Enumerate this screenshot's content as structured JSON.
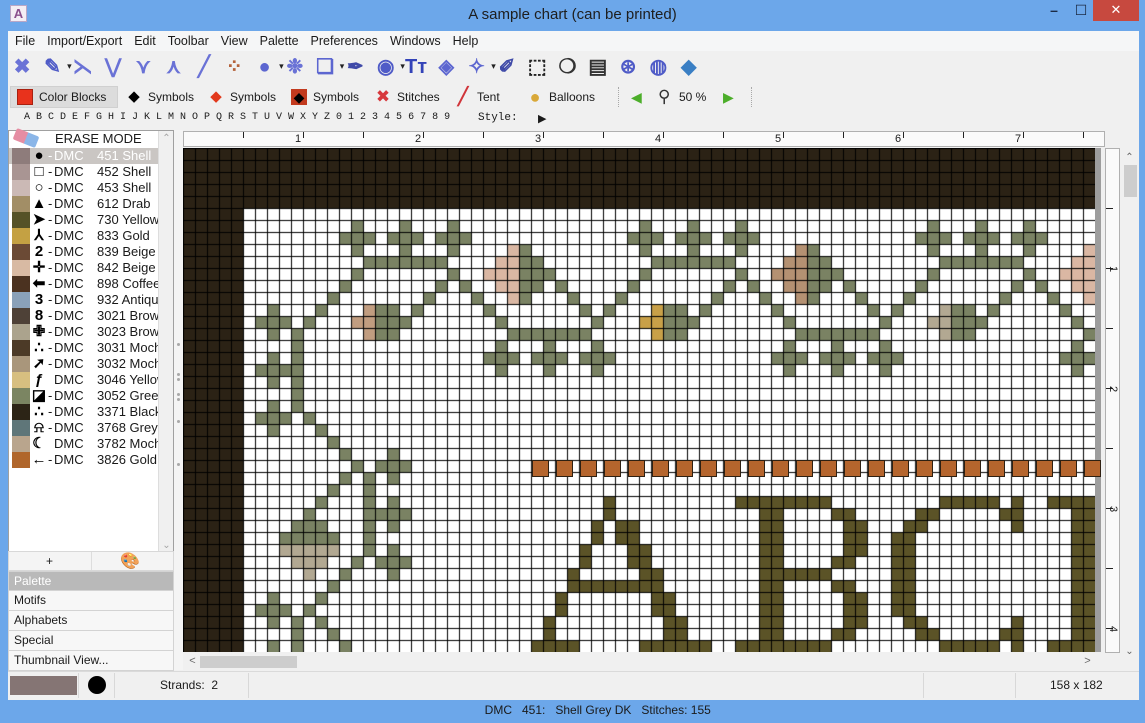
{
  "window": {
    "title": "A sample chart (can be printed)",
    "minimize": "–",
    "maximize": "☐",
    "close": "✕",
    "app_icon": "A"
  },
  "menu": {
    "items": [
      "File",
      "Import/Export",
      "Edit",
      "Toolbar",
      "View",
      "Palette",
      "Preferences",
      "Windows",
      "Help"
    ]
  },
  "toolbar": {
    "dropdown_glyph": "▾",
    "tools": [
      {
        "name": "full-stitch",
        "glyph": "✖",
        "color": "#6a72d6",
        "dropdown": false
      },
      {
        "name": "brush",
        "glyph": "✎",
        "color": "#4f5bc7",
        "dropdown": true
      },
      {
        "name": "half-stitch-back",
        "glyph": "⋋",
        "color": "#6a72d6",
        "dropdown": false
      },
      {
        "name": "three-quarter-stitch-a",
        "glyph": "⋁",
        "color": "#6a72d6",
        "dropdown": false
      },
      {
        "name": "three-quarter-stitch-b",
        "glyph": "⋎",
        "color": "#6a72d6",
        "dropdown": false
      },
      {
        "name": "three-quarter-stitch-c",
        "glyph": "⋏",
        "color": "#6a72d6",
        "dropdown": false
      },
      {
        "name": "half-stitch-forward",
        "glyph": "╱",
        "color": "#6a72d6",
        "dropdown": false
      },
      {
        "name": "quarter-stitch",
        "glyph": "⁘",
        "color": "#b5623a",
        "dropdown": false
      },
      {
        "name": "french-knot",
        "glyph": "●",
        "color": "#5c66d0",
        "dropdown": true
      },
      {
        "name": "bead",
        "glyph": "❉",
        "color": "#6a72d6",
        "dropdown": false
      },
      {
        "name": "shapes",
        "glyph": "❏",
        "color": "#5c66d0",
        "dropdown": true
      },
      {
        "name": "backstitch-pen",
        "glyph": "✒",
        "color": "#3f4aa8",
        "dropdown": false
      },
      {
        "name": "view-eye",
        "glyph": "◉",
        "color": "#4f5bc7",
        "dropdown": true
      },
      {
        "name": "text",
        "glyph": "Tт",
        "color": "#3343b8",
        "dropdown": false
      },
      {
        "name": "fill-bucket",
        "glyph": "◈",
        "color": "#5c66d0",
        "dropdown": false
      },
      {
        "name": "magic-wand",
        "glyph": "✧",
        "color": "#5c66d0",
        "dropdown": true
      },
      {
        "name": "eyedropper",
        "glyph": "✐",
        "color": "#3f4aa8",
        "dropdown": false
      },
      {
        "name": "select-rectangle",
        "glyph": "⬚",
        "color": "#222222",
        "dropdown": false
      },
      {
        "name": "comment-bubble",
        "glyph": "❍",
        "color": "#333333",
        "dropdown": false
      },
      {
        "name": "clipboard-paste",
        "glyph": "▤",
        "color": "#333333",
        "dropdown": false
      },
      {
        "name": "help-lifebuoy",
        "glyph": "⊛",
        "color": "#4f5bc7",
        "dropdown": false
      },
      {
        "name": "globe",
        "glyph": "◍",
        "color": "#4f5bc7",
        "dropdown": false
      },
      {
        "name": "book",
        "glyph": "◆",
        "color": "#3a7fc4",
        "dropdown": false
      }
    ]
  },
  "view_modes": {
    "items": [
      {
        "label": "Color Blocks",
        "selected": true
      },
      {
        "label": "Symbols"
      },
      {
        "label": "Symbols"
      },
      {
        "label": "Symbols"
      },
      {
        "label": "Stitches"
      },
      {
        "label": "Tent"
      },
      {
        "label": "Balloons"
      }
    ],
    "icons": {
      "diamond": "◆",
      "stitches": "✖",
      "tent": "╱",
      "balloon": "●",
      "prev": "◀",
      "next": "▶",
      "zoom": "⚲"
    },
    "zoom_value": "50 %"
  },
  "alphabet_bar": {
    "letters": "A B C D E F G H I J K L M N O P Q R S T U V W X Y Z 0 1 2 3 4 5 6 7 8 9",
    "style_label": "Style:",
    "style_arrow": "▶"
  },
  "palette": {
    "erase_label": "ERASE MODE",
    "add_label": "+",
    "scroll_up": "⌃",
    "scroll_down": "⌄",
    "items": [
      {
        "swatch": "#8e7c7b",
        "symbol": "●",
        "dash": "-",
        "brand": "DMC",
        "code": "451",
        "name": "Shell",
        "selected": true
      },
      {
        "swatch": "#a99593",
        "symbol": "□",
        "dash": "-",
        "brand": "DMC",
        "code": "452",
        "name": "Shell"
      },
      {
        "swatch": "#cbb9b5",
        "symbol": "○",
        "dash": "-",
        "brand": "DMC",
        "code": "453",
        "name": "Shell"
      },
      {
        "swatch": "#a28e66",
        "symbol": "▲",
        "dash": "-",
        "brand": "DMC",
        "code": "612",
        "name": "Drab"
      },
      {
        "swatch": "#555227",
        "symbol": "➤",
        "dash": "-",
        "brand": "DMC",
        "code": "730",
        "name": "Yellow"
      },
      {
        "swatch": "#c4a143",
        "symbol": "⅄",
        "dash": "-",
        "brand": "DMC",
        "code": "833",
        "name": "Gold"
      },
      {
        "swatch": "#6b4a35",
        "symbol": "2",
        "dash": "-",
        "brand": "DMC",
        "code": "839",
        "name": "Beige"
      },
      {
        "swatch": "#d8baa3",
        "symbol": "✛",
        "dash": "-",
        "brand": "DMC",
        "code": "842",
        "name": "Beige"
      },
      {
        "swatch": "#4b3220",
        "symbol": "⬅",
        "dash": "-",
        "brand": "DMC",
        "code": "898",
        "name": "Coffee"
      },
      {
        "swatch": "#8aa1b9",
        "symbol": "3",
        "dash": "-",
        "brand": "DMC",
        "code": "932",
        "name": "Antique"
      },
      {
        "swatch": "#4e4137",
        "symbol": "8",
        "dash": "-",
        "brand": "DMC",
        "code": "3021",
        "name": "Brown"
      },
      {
        "swatch": "#aba38d",
        "symbol": "✙",
        "dash": "-",
        "brand": "DMC",
        "code": "3023",
        "name": "Brown"
      },
      {
        "swatch": "#4c3a27",
        "symbol": "∴",
        "dash": "-",
        "brand": "DMC",
        "code": "3031",
        "name": "Mocha"
      },
      {
        "swatch": "#a9967b",
        "symbol": "➚",
        "dash": "-",
        "brand": "DMC",
        "code": "3032",
        "name": "Mocha"
      },
      {
        "swatch": "#d7bf80",
        "symbol": "ƒ",
        "dash": "",
        "brand": "DMC",
        "code": "3046",
        "name": "Yellow"
      },
      {
        "swatch": "#7b8562",
        "symbol": "◪",
        "dash": "-",
        "brand": "DMC",
        "code": "3052",
        "name": "Green"
      },
      {
        "swatch": "#2c2416",
        "symbol": "∴",
        "dash": "-",
        "brand": "DMC",
        "code": "3371",
        "name": "Black"
      },
      {
        "swatch": "#5f7679",
        "symbol": "⍾",
        "dash": "-",
        "brand": "DMC",
        "code": "3768",
        "name": "Grey"
      },
      {
        "swatch": "#b9a58d",
        "symbol": "☾",
        "dash": "",
        "brand": "DMC",
        "code": "3782",
        "name": "Mocha"
      },
      {
        "swatch": "#b0662b",
        "symbol": "←",
        "dash": "-",
        "brand": "DMC",
        "code": "3826",
        "name": "Gold"
      }
    ]
  },
  "side_tabs": [
    {
      "label": "Palette",
      "selected": true
    },
    {
      "label": "Motifs"
    },
    {
      "label": "Alphabets"
    },
    {
      "label": "Special"
    },
    {
      "label": "Thumbnail View..."
    }
  ],
  "rulers": {
    "horizontal": [
      "1",
      "2",
      "3",
      "4",
      "5",
      "6",
      "7"
    ],
    "vertical": [
      "1",
      "2",
      "3",
      "4"
    ]
  },
  "scrollbars": {
    "left": "<",
    "right": ">",
    "up": "⌃",
    "down": "⌄"
  },
  "chart": {
    "cols": 76,
    "rows": 42,
    "legend": {
      "K": "#2b2215",
      ".": "#ffffff",
      "g": "#7a8263",
      "p": "#dab7a3",
      "b": "#b49172",
      "o": "#c8a048",
      "y": "#b2a892",
      "t": "#c19d80",
      "a": "#5b5327"
    },
    "grid": [
      "KKKKKKKKKK KKKKKKKKKK KKKKKKKKKK KKKKKKKKKK KKKKKKKKKK KKKKKKKKKK KKKKKKKKKK KKKKKK",
      "KKKKKKKKKK KKKKKKKKKK KKKKKKKKKK KKKKKKKKKK KKKKKKKKKK KKKKKKKKKK KKKKKKKKKK KKKKKK",
      "KKKKKKKKKK KKKKKKKKKK KKKKKKKKKK KKKKKKKKKK KKKKKKKKKK KKKKKKKKKK KKKKKKKKKK KKKKKK",
      "KKKKKKKKKK KKKKKKKKKK KKKKKKKKKK KKKKKKKKKK KKKKKKKKKK KKKKKKKKKK KKKKKKKKKK KKKKKK",
      "KKKKKKKKKK KKKKKKKKKK KKKKKKKKKK KKKKKKKKKK KKKKKKKKKK KKKKKKKKKK KKKKKKKKKK KKKKKK",
      "KKKKK..... .......... .......... .......... .......... .......... .......... ......",
      "KKKKK..... ....g...g. ..g....... ........g. ..g...g... .......... ..g...g... g.....",
      "KKKKK..... ...ggg.ggg .ggg...... .......ggg .ggg.ggg.. .......... .ggg.ggg.g gg....",
      "KKKKK..... ....g...g. ..g....pg. ........g. ..g...g... .bg....... ..g...g... g....p",
      "KKKKK..... .....ggggg gg....ppgg .........g gggggg.... bbgg...... ...ggggggg ....pp",
      "KKKKK..... ....g..... ..g..pppgg g.......g. ......g..b bbggg..... ..g....... g..ppp",
      "KKKKK..... ...g...... .g.g..ppgg .g.....g.. .....g.g.. bbgg.g.... .g.......g .g..pp",
      "KKKKK..... ..g....... g...g..pg. ..g...g... ....g...g. .bg...g... g.......g. ..g..p",
      "KKKKK..g.. .g...tgg.g .....g.... ...g.g...o gg.g.....g .......g.g ...ygg.g.. ...g..",
      "KKKKK.ggg. g...ttggg. ......g... ....g...oo ggg....... g.......g. ..yyggg... ....g.",
      "KKKKK..g.g .....tgg.. .......ggg gggg.....o gg........ .ggggggg.. ...ygg.... .....g",
      "KKKKK....g .......... ......g... g...g..... .......... g...g...g. .......... ....g.",
      "KKKKK..g.g .......... .....ggg.g gg.ggg.... .........g gg.ggg.ggg .......... ...ggg",
      "KKKKK.gggg .......... ......g... g...g..... .......... g...g...g. .......... ....g.",
      "KKKKK..g.g .......... .......... .......... .......... .......... .......... ......",
      "KKKKK....g .......... .......... .......... .......... .......... .......... ......",
      "KKKKK..g.g .......... .......... .......... .......... .......... .......... ......",
      "KKKKK.ggg. g......... .......... .......... .......... .......... .......... ......",
      "KKKKK..g.. .g........ .......... .......... .......... .......... .......... ......",
      "KKKKK..... ..g....... .......... .......... .......... .......... .......... ......",
      "KKKKK..... ...g...g.. .......... .......... .......... .......... .......... ......",
      "KKKKK..... ....g.ggg. .......... .......... .......... .......... .......... ......",
      "KKKKK..... ...g.g.g.. .......... .......... .......... .......... .......... ......",
      "KKKKK..... ..g..g.... .......... .......... .......... .......... .......... ......",
      "KKKKK..... .g...g.g.. .......... .....a.... ......aaaa aaaa...... ...aaaaa.a ..aaaa",
      "KKKKK..... g....gggg. .......... .....a.... ........aa ....aa.... .aa.....aa ....aa",
      "KKKKK....g gg...g.g.. .......... ....a.aa.. ........aa .....aa... aa.......a ....aa",
      "KKKKK...gg ggg..g.... .......... ....a.aa.. ........aa .....aa..a a......... ....aa",
      "KKKKK...yy yyy..g.g.. .......... ...a...aa. ........aa .....aa..a a......... ....aa",
      "KKKKK....y yy..g.ggg. .......... ...a...aa. ........aa ....aa...a a......... ....aa",
      "KKKKK..... y..g...g.. .......... ..a.....aa ........aa aaaa.....a a......... ....aa",
      "KKKKK..... ..g....... .......... ..aaaaaaaa ........aa ....aa...a a......... ....aa",
      "KKKKK..g.. .g........ .......... .a.......a a.......aa .....aa..a a......... ....aa",
      "KKKKK.ggg. g......... .......... .a.......a a.......aa .....aa..a a......... ....aa",
      "KKKKK..g.g .g........ .......... a......... aa......aa .....aa... aa.......a ....aa",
      "KKKKK....g ..g....... .......... a......... aa......aa ....aa.... .aa.....aa ....aa",
      "KKKKK..g.g ...g...... .........a aaa.....aa aaaa..aaaa aaaa...... ...aaaaa.a ..aaaa"
    ],
    "beads": {
      "row": 26,
      "col_start": 29,
      "col_step": 2,
      "count": 24,
      "color": "#b5652d"
    }
  },
  "status": {
    "swatch": "#857574",
    "strands_label": "Strands:",
    "strands": "2",
    "thread": "DMC   451:   Shell Grey DK",
    "stitches_label": "Stitches:",
    "stitches": "155",
    "dimensions": "158 x 182"
  }
}
